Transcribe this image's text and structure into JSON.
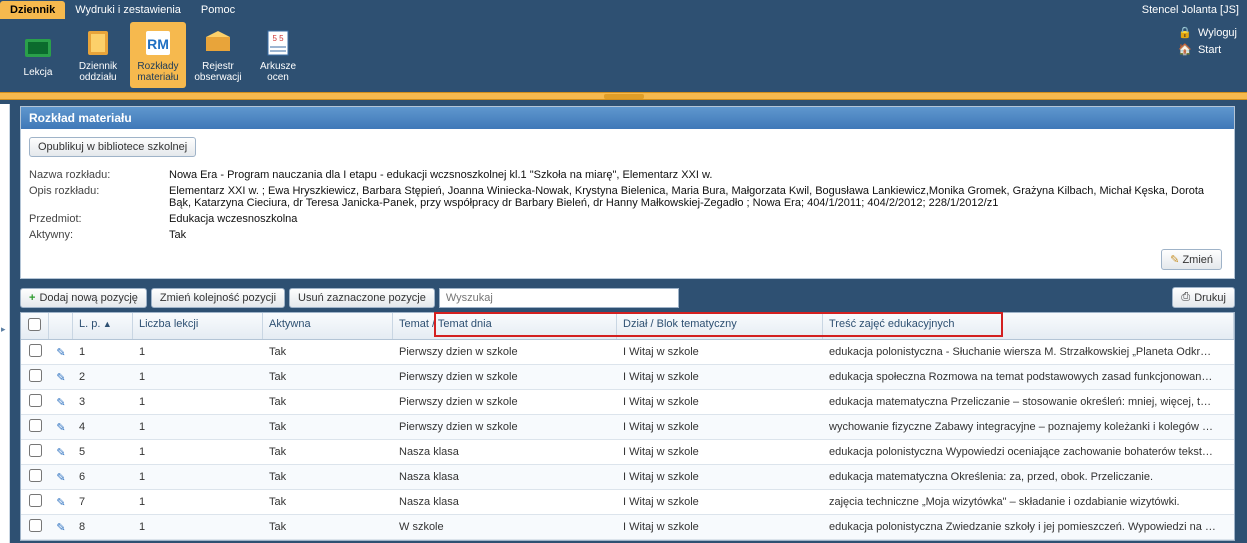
{
  "user": "Stencel Jolanta [JS]",
  "topTabs": [
    {
      "label": "Dziennik",
      "active": true
    },
    {
      "label": "Wydruki i zestawienia",
      "active": false
    },
    {
      "label": "Pomoc",
      "active": false
    }
  ],
  "ribbon": [
    {
      "label": "Lekcja"
    },
    {
      "label": "Dziennik oddziału"
    },
    {
      "label": "Rozkłady materiału",
      "active": true
    },
    {
      "label": "Rejestr obserwacji"
    },
    {
      "label": "Arkusze ocen"
    }
  ],
  "rightLinks": {
    "logout": "Wyloguj",
    "start": "Start"
  },
  "panel": {
    "title": "Rozkład materiału",
    "publishBtn": "Opublikuj w bibliotece szkolnej",
    "labels": {
      "nazwa": "Nazwa rozkładu:",
      "opis": "Opis rozkładu:",
      "przedmiot": "Przedmiot:",
      "aktywny": "Aktywny:"
    },
    "values": {
      "nazwa": "Nowa Era - Program nauczania dla I etapu - edukacji wczsnoszkolnej kl.1 \"Szkoła na miarę\", Elementarz XXI w.",
      "opis": "Elementarz XXI w. ; Ewa Hryszkiewicz, Barbara Stępień, Joanna Winiecka-Nowak, Krystyna Bielenica, Maria Bura, Małgorzata Kwil, Bogusława Lankiewicz,Monika Gromek, Grażyna Kilbach, Michał Kęska,  Dorota Bąk, Katarzyna Cieciura, dr Teresa Janicka-Panek,  przy współpracy dr Barbary Bieleń,  dr Hanny Małkowskiej-Zegadło ; Nowa Era; 404/1/2011; 404/2/2012; 228/1/2012/z1",
      "przedmiot": "Edukacja wczesnoszkolna",
      "aktywny": "Tak"
    },
    "changeBtn": "Zmień"
  },
  "toolbar": {
    "add": "Dodaj nową pozycję",
    "reorder": "Zmień kolejność pozycji",
    "delete": "Usuń zaznaczone pozycje",
    "searchPlaceholder": "Wyszukaj",
    "print": "Drukuj"
  },
  "columns": {
    "lp": "L. p.",
    "liczba": "Liczba lekcji",
    "aktywna": "Aktywna",
    "temat": "Temat / Temat dnia",
    "dzial": "Dział / Blok tematyczny",
    "tresc": "Treść zajęć edukacyjnych"
  },
  "rows": [
    {
      "lp": "1",
      "liczba": "1",
      "aktywna": "Tak",
      "temat": "Pierwszy dzien w szkole",
      "dzial": "I Witaj w szkole",
      "tresc": "edukacja polonistyczna - Słuchanie wiersza M. Strzałkowskiej „Planeta Odkr…"
    },
    {
      "lp": "2",
      "liczba": "1",
      "aktywna": "Tak",
      "temat": "Pierwszy dzien w szkole",
      "dzial": "I Witaj w szkole",
      "tresc": "edukacja społeczna Rozmowa na temat podstawowych zasad funkcjonowan…"
    },
    {
      "lp": "3",
      "liczba": "1",
      "aktywna": "Tak",
      "temat": "Pierwszy dzien w szkole",
      "dzial": "I Witaj w szkole",
      "tresc": "edukacja matematyczna Przeliczanie – stosowanie określeń: mniej, więcej, t…"
    },
    {
      "lp": "4",
      "liczba": "1",
      "aktywna": "Tak",
      "temat": "Pierwszy dzien w szkole",
      "dzial": "I Witaj w szkole",
      "tresc": "wychowanie fizyczne Zabawy integracyjne – poznajemy koleżanki i kolegów …"
    },
    {
      "lp": "5",
      "liczba": "1",
      "aktywna": "Tak",
      "temat": "Nasza klasa",
      "dzial": "I Witaj w szkole",
      "tresc": "edukacja polonistyczna Wypowiedzi oceniające zachowanie bohaterów tekst…"
    },
    {
      "lp": "6",
      "liczba": "1",
      "aktywna": "Tak",
      "temat": "Nasza klasa",
      "dzial": "I Witaj w szkole",
      "tresc": "edukacja matematyczna Określenia: za, przed, obok. Przeliczanie."
    },
    {
      "lp": "7",
      "liczba": "1",
      "aktywna": "Tak",
      "temat": "Nasza klasa",
      "dzial": "I Witaj w szkole",
      "tresc": "zajęcia techniczne „Moja wizytówka\" – składanie i ozdabianie wizytówki."
    },
    {
      "lp": "8",
      "liczba": "1",
      "aktywna": "Tak",
      "temat": "W szkole",
      "dzial": "I Witaj w szkole",
      "tresc": "edukacja polonistyczna Zwiedzanie szkoły i jej pomieszczeń. Wypowiedzi na …"
    }
  ],
  "icons": {
    "plus": "+",
    "pencil": "✎",
    "printer": "⎙",
    "lock": "🔒",
    "home": "🏠"
  }
}
